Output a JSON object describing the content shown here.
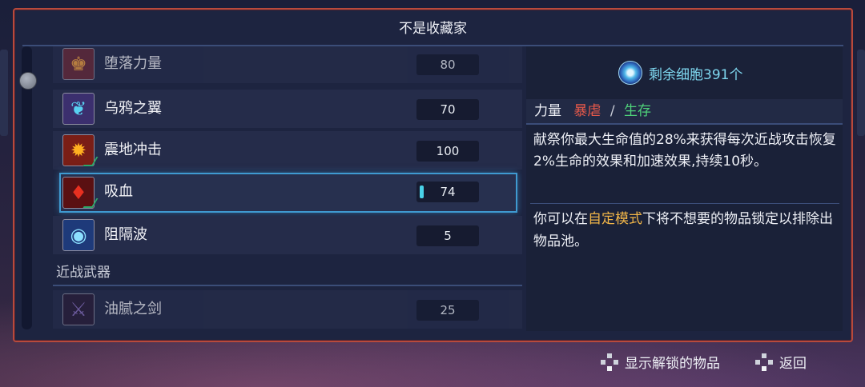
{
  "window": {
    "title": "不是收藏家"
  },
  "list": {
    "items": [
      {
        "name": "堕落力量",
        "cost": "80",
        "icon": "fallen-power-icon",
        "color": "#6a2a3a",
        "glyph": "♚"
      },
      {
        "name": "乌鸦之翼",
        "cost": "70",
        "icon": "raven-wing-icon",
        "color": "#3b2f6e",
        "glyph": "❦"
      },
      {
        "name": "震地冲击",
        "cost": "100",
        "icon": "ground-shock-icon",
        "color": "#7a1e16",
        "glyph": "✹"
      },
      {
        "name": "吸血",
        "cost": "74",
        "icon": "blood-drop-icon",
        "color": "#5a1012",
        "glyph": "♦"
      },
      {
        "name": "阻隔波",
        "cost": "5",
        "icon": "barrier-wave-icon",
        "color": "#1e3a7a",
        "glyph": "◉"
      }
    ],
    "section": {
      "label": "近战武器"
    },
    "section_items": [
      {
        "name": "油腻之剑",
        "cost": "25",
        "icon": "greasy-sword-icon",
        "color": "#2a1e3a",
        "glyph": "⚔"
      }
    ]
  },
  "detail": {
    "cells_label": "剩余细胞391个",
    "stat_force": "力量",
    "stat_brutality": "暴虐",
    "stat_sep": "/",
    "stat_survival": "生存",
    "description": "献祭你最大生命值的28%来获得每次近战攻击恢复2%生命的效果和加速效果,持续10秒。",
    "note_prefix": "你可以在",
    "note_highlight": "自定模式",
    "note_suffix": "下将不想要的物品锁定以排除出物品池。"
  },
  "footer": {
    "show_unlocked": "显示解锁的物品",
    "back": "返回"
  }
}
